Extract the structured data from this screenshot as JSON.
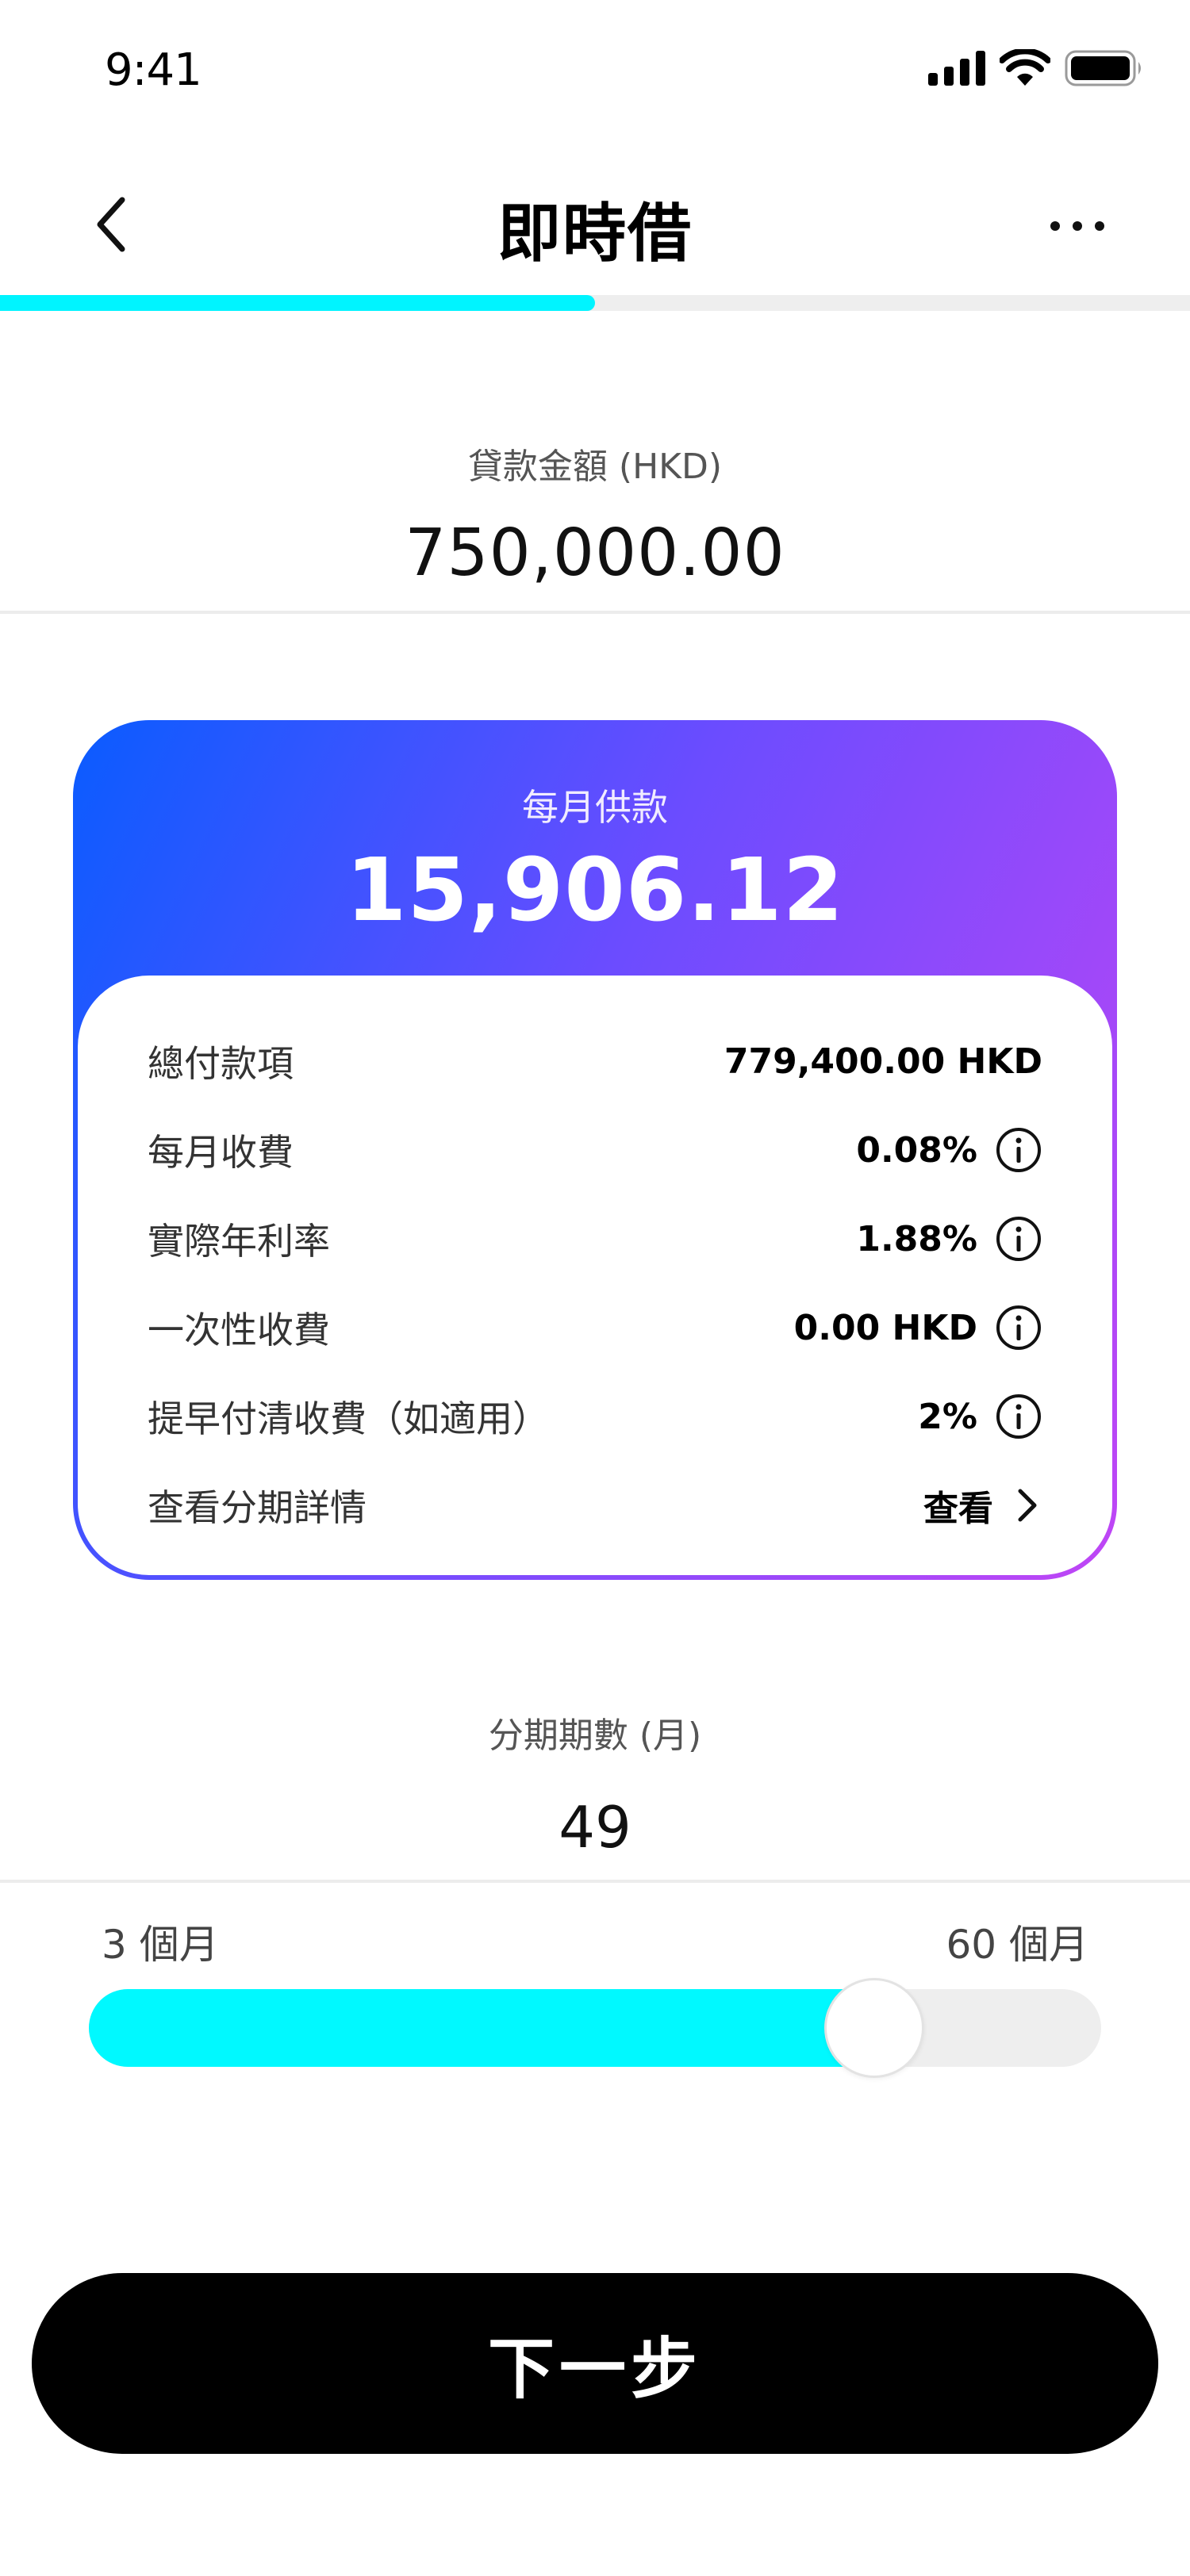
{
  "status_bar": {
    "time": "9:41"
  },
  "nav": {
    "title": "即時借"
  },
  "progress": {
    "fraction": 0.5
  },
  "loan": {
    "label": "貸款金額 (HKD)",
    "value": "750,000.00"
  },
  "card": {
    "title": "每月供款",
    "amount": "15,906.12",
    "rows": [
      {
        "label": "總付款項",
        "value": "779,400.00 HKD",
        "icon": ""
      },
      {
        "label": "每月收費",
        "value": "0.08%",
        "icon": "info-icon"
      },
      {
        "label": "實際年利率",
        "value": "1.88%",
        "icon": "info-icon"
      },
      {
        "label": "一次性收費",
        "value": "0.00 HKD",
        "icon": "info-icon"
      },
      {
        "label": "提早付清收費（如適用）",
        "value": "2%",
        "icon": "info-icon"
      },
      {
        "label": "查看分期詳情",
        "value": "查看",
        "icon": "chevron-right-icon"
      }
    ]
  },
  "term": {
    "label": "分期期數 (月)",
    "value": "49",
    "min_label": "3 個月",
    "max_label": "60 個月",
    "min": 3,
    "max": 60,
    "current": 49
  },
  "next_button": {
    "label": "下一步"
  },
  "colors": {
    "accent": "#00f4ff",
    "card_gradient_start": "#0a5cff",
    "card_gradient_end": "#c046f5",
    "button": "#000000"
  }
}
